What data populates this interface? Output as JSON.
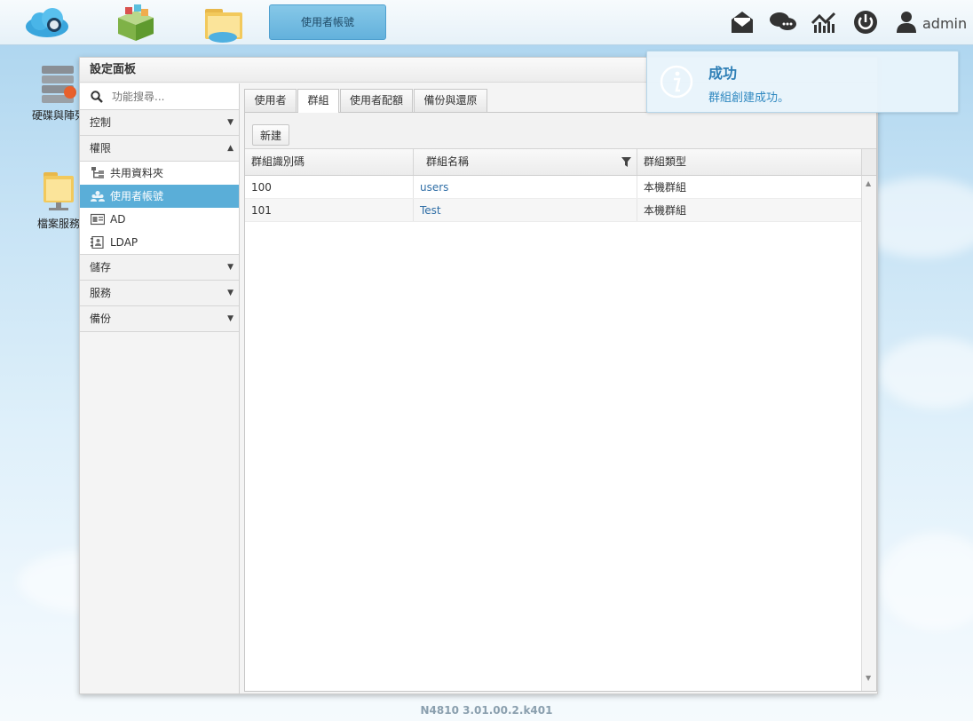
{
  "taskbar": {
    "active_task": "使用者帳號",
    "user": "admin",
    "apps": [
      "cloud-icon",
      "app-center-icon",
      "file-folder-icon"
    ],
    "tray": [
      "mail-icon",
      "chat-icon",
      "network-icon",
      "power-icon",
      "user-icon"
    ]
  },
  "desktop": {
    "icons": [
      {
        "label": "硬碟與陣列",
        "icon": "disk-array-icon"
      },
      {
        "label": "檔案服務",
        "icon": "file-service-icon"
      }
    ]
  },
  "window": {
    "title": "設定面板",
    "search_placeholder": "功能搜尋...",
    "sections": [
      {
        "label": "控制",
        "arrow": "▼"
      },
      {
        "label": "權限",
        "arrow": "▲"
      },
      {
        "label": "儲存",
        "arrow": "▼"
      },
      {
        "label": "服務",
        "arrow": "▼"
      },
      {
        "label": "備份",
        "arrow": "▼"
      }
    ],
    "permission_items": [
      {
        "label": "共用資料夾",
        "icon": "folder-tree-icon"
      },
      {
        "label": "使用者帳號",
        "icon": "users-icon",
        "selected": true
      },
      {
        "label": "AD",
        "icon": "ad-card-icon"
      },
      {
        "label": "LDAP",
        "icon": "ldap-book-icon"
      }
    ],
    "tabs": [
      "使用者",
      "群組",
      "使用者配額",
      "備份與還原"
    ],
    "active_tab": "群組",
    "toolbar": {
      "new_label": "新建"
    },
    "grid": {
      "columns": [
        "群組識別碼",
        "群組名稱",
        "群組類型"
      ],
      "rows": [
        {
          "id": "100",
          "name": "users",
          "type": "本機群組"
        },
        {
          "id": "101",
          "name": "Test",
          "type": "本機群組"
        }
      ]
    }
  },
  "notification": {
    "title": "成功",
    "message": "群組創建成功。"
  },
  "footer": {
    "version": "N4810   3.01.00.2.k401"
  },
  "colors": {
    "accent": "#5aaed8",
    "link": "#2f6ea6",
    "notify_text": "#2f7fb6"
  }
}
